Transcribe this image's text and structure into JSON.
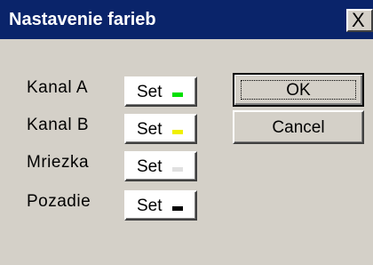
{
  "window": {
    "title": "Nastavenie farieb",
    "close_glyph": "X"
  },
  "channels": [
    {
      "label": "Kanal  A",
      "button_label": "Set",
      "color": "#00e000"
    },
    {
      "label": "Kanal  B",
      "button_label": "Set",
      "color": "#f0f000"
    },
    {
      "label": "Mriezka",
      "button_label": "Set",
      "color": "#e0e0e0"
    },
    {
      "label": "Pozadie",
      "button_label": "Set",
      "color": "#000000"
    }
  ],
  "actions": {
    "ok_label": "OK",
    "cancel_label": "Cancel"
  },
  "colors": {
    "titlebar": "#0a246a",
    "dialog_bg": "#d4d0c8"
  }
}
